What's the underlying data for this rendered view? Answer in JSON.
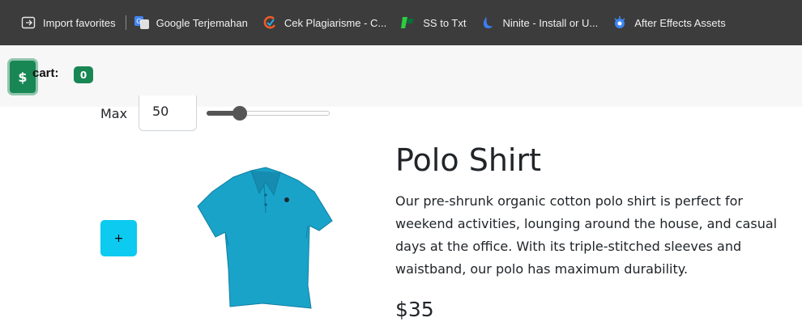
{
  "bookmarks": [
    {
      "label": "Import favorites",
      "icon": "import-icon"
    },
    {
      "label": "Google Terjemahan",
      "icon": "google-translate-icon"
    },
    {
      "label": "Cek Plagiarisme - C...",
      "icon": "plagiarism-icon"
    },
    {
      "label": "SS to Txt",
      "icon": "ss-to-txt-icon"
    },
    {
      "label": "Ninite - Install or U...",
      "icon": "ninite-icon"
    },
    {
      "label": "After Effects Assets",
      "icon": "after-effects-icon"
    }
  ],
  "cart": {
    "button_icon": "$",
    "label": "cart:",
    "count": "0"
  },
  "filter": {
    "max_label": "Max",
    "max_value": "50",
    "slider_fraction": 0.27
  },
  "product": {
    "add_label": "+",
    "name": "Polo Shirt",
    "description": "Our pre-shrunk organic cotton polo shirt is perfect for weekend activities, lounging around the house, and casual days at the office. With its triple-stitched sleeves and waistband, our polo has maximum durability.",
    "price": "$35",
    "image_color": "#1aa3c9"
  },
  "colors": {
    "bookmarks_bg": "#3c3c3c",
    "cart_green": "#198754",
    "add_button": "#0dcaf0"
  }
}
